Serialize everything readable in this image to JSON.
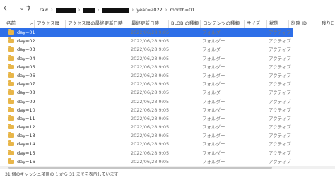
{
  "toolbar": {
    "back_glyph": "🡐",
    "forward_glyph": "🡒",
    "dropdown_glyph": "⌄",
    "up_glyph": "🡑",
    "crumbs": [
      "raw",
      "year=2022",
      "month=01"
    ]
  },
  "header": {
    "name": "名前",
    "access_tier": "アクセス層",
    "access_tier_modified": "アクセス層の最終更新日時",
    "last_modified": "最終更新日時",
    "blob_type": "BLOB の種類",
    "content_type": "コンテンツの種類",
    "size": "サイズ",
    "status": "状態",
    "deleted_id": "削除 ID",
    "remaining": "残りE"
  },
  "rows": [
    {
      "name": "day=01",
      "modified": "2022/06/28 9:05",
      "type": "フォルダー",
      "status": "アクティブ"
    },
    {
      "name": "day=02",
      "modified": "2022/06/28 9:05",
      "type": "フォルダー",
      "status": "アクティブ"
    },
    {
      "name": "day=03",
      "modified": "2022/06/28 9:05",
      "type": "フォルダー",
      "status": "アクティブ"
    },
    {
      "name": "day=04",
      "modified": "2022/06/28 9:05",
      "type": "フォルダー",
      "status": "アクティブ"
    },
    {
      "name": "day=05",
      "modified": "2022/06/28 9:05",
      "type": "フォルダー",
      "status": "アクティブ"
    },
    {
      "name": "day=06",
      "modified": "2022/06/28 9:05",
      "type": "フォルダー",
      "status": "アクティブ"
    },
    {
      "name": "day=07",
      "modified": "2022/06/28 9:05",
      "type": "フォルダー",
      "status": "アクティブ"
    },
    {
      "name": "day=08",
      "modified": "2022/06/28 9:05",
      "type": "フォルダー",
      "status": "アクティブ"
    },
    {
      "name": "day=09",
      "modified": "2022/06/28 9:05",
      "type": "フォルダー",
      "status": "アクティブ"
    },
    {
      "name": "day=10",
      "modified": "2022/06/28 9:05",
      "type": "フォルダー",
      "status": "アクティブ"
    },
    {
      "name": "day=11",
      "modified": "2022/06/28 9:05",
      "type": "フォルダー",
      "status": "アクティブ"
    },
    {
      "name": "day=12",
      "modified": "2022/06/28 9:05",
      "type": "フォルダー",
      "status": "アクティブ"
    },
    {
      "name": "day=13",
      "modified": "2022/06/28 9:05",
      "type": "フォルダー",
      "status": "アクティブ"
    },
    {
      "name": "day=14",
      "modified": "2022/06/28 9:05",
      "type": "フォルダー",
      "status": "アクティブ"
    },
    {
      "name": "day=15",
      "modified": "2022/06/28 9:05",
      "type": "フォルダー",
      "status": "アクティブ"
    },
    {
      "name": "day=16",
      "modified": "2022/06/28 9:05",
      "type": "フォルダー",
      "status": "アクティブ"
    }
  ],
  "status_bar": "31 個のキャッシュ項目の 1 から 31 までを表示しています",
  "colors": {
    "selection": "#2e6fe8",
    "folder": "#e8b64a"
  }
}
